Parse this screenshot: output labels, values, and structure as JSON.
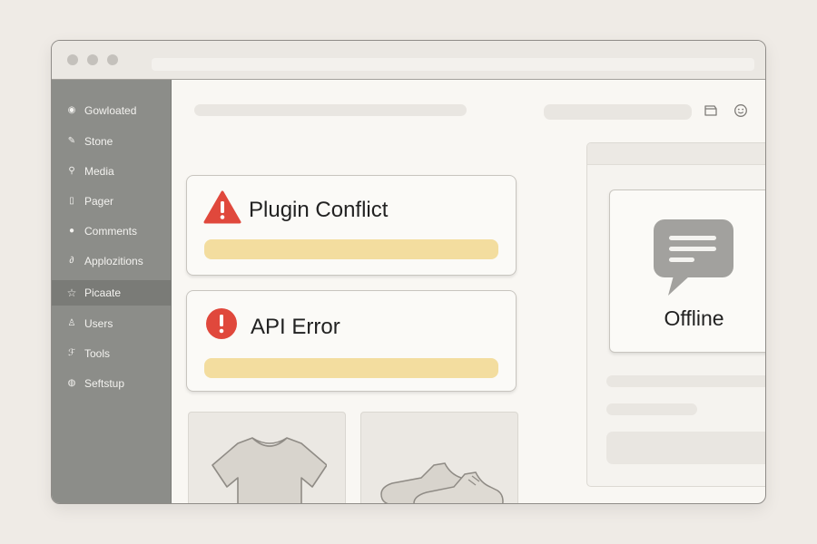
{
  "window": {
    "controls": [
      "close-dot",
      "minimize-dot",
      "maximize-dot"
    ]
  },
  "sidebar": {
    "items": [
      {
        "label": "Gowloated",
        "icon": "dashboard-icon"
      },
      {
        "label": "Stone",
        "icon": "pin-icon"
      },
      {
        "label": "Media",
        "icon": "media-icon"
      },
      {
        "label": "Pager",
        "icon": "page-icon"
      },
      {
        "label": "Comments",
        "icon": "comment-icon"
      },
      {
        "label": "Applozitions",
        "icon": "appearance-icon"
      },
      {
        "label": "Picaate",
        "icon": "star-icon",
        "active": true
      },
      {
        "label": "Users",
        "icon": "users-icon"
      },
      {
        "label": "Tools",
        "icon": "wrench-icon"
      },
      {
        "label": "Seftstup",
        "icon": "settings-icon"
      }
    ]
  },
  "header": {
    "icons": [
      "inbox-icon",
      "smiley-icon"
    ]
  },
  "alerts": [
    {
      "title": "Plugin Conflict",
      "icon": "warning-triangle-icon",
      "color": "#e0483c"
    },
    {
      "title": "API Error",
      "icon": "error-circle-icon",
      "color": "#e0483c"
    }
  ],
  "status": {
    "label": "Offline",
    "icon": "chat-bubble-icon"
  },
  "products": [
    {
      "icon": "tshirt-icon"
    },
    {
      "icon": "shoe-icon"
    }
  ],
  "colors": {
    "accent_bar": "#f3dd9f",
    "alert_red": "#e0483c",
    "sidebar_bg": "#8c8d89",
    "sidebar_active": "#7a7b77"
  }
}
